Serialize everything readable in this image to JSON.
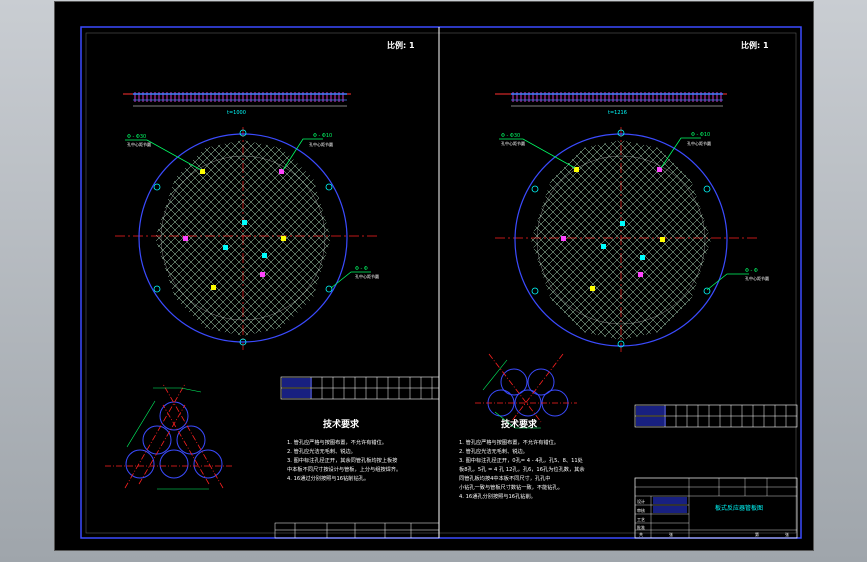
{
  "drawing": {
    "sheets": [
      {
        "scale_text": "比例: 1",
        "pitch_text": "t=1000",
        "callout_left": "Φ - Φ30",
        "callout_left_sub": "孔中心距节圆",
        "callout_right": "Φ - Φ10",
        "callout_right_sub": "孔中心距节圆",
        "callout_bottom": "Φ - Φ",
        "callout_bottom_sub": "孔中心距节圆",
        "tech_title": "技术要求",
        "tech_lines": [
          "1. 管孔应严格与按图布置，不允许有错位。",
          "2. 管孔应光洁无毛刺、锐边。",
          "3. 图中标注孔径正开，其余同管孔板均按上板按",
          "中本板不同尺寸按设计与管板，上分与组按焊齐。",
          "4. 16通过分别按照与16钻削钻孔。"
        ]
      },
      {
        "scale_text": "比例: 1",
        "pitch_text": "t=1216",
        "callout_left": "Φ - Φ30",
        "callout_left_sub": "孔中心距节圆",
        "callout_right": "Φ - Φ10",
        "callout_right_sub": "孔中心距节圆",
        "callout_bottom": "Φ - Φ",
        "callout_bottom_sub": "孔中心距节圆",
        "tech_title": "技术要求",
        "tech_lines": [
          "1. 管孔应严格与按图布置，不允许有错位。",
          "2. 管孔应光洁无毛刺、锐边。",
          "3. 图中标注孔径正开，0孔= 4 - 4孔，孔5、8、11处",
          "板8孔，5孔 = 4 孔 12孔，孔6，16孔为位孔数，其余",
          "同管孔板均按4中本板不同尺寸，孔孔中",
          "小钻孔一致与管板尺寸数钻一致，不能钻孔。",
          "4. 16通孔分别按照与16孔钻削。"
        ]
      }
    ],
    "title_block": {
      "drawing_title": "板式反应器管板图",
      "rows": [
        "设计",
        "审核",
        "工艺",
        "批准"
      ],
      "footer": [
        "共",
        "张",
        "第",
        "张"
      ]
    }
  }
}
